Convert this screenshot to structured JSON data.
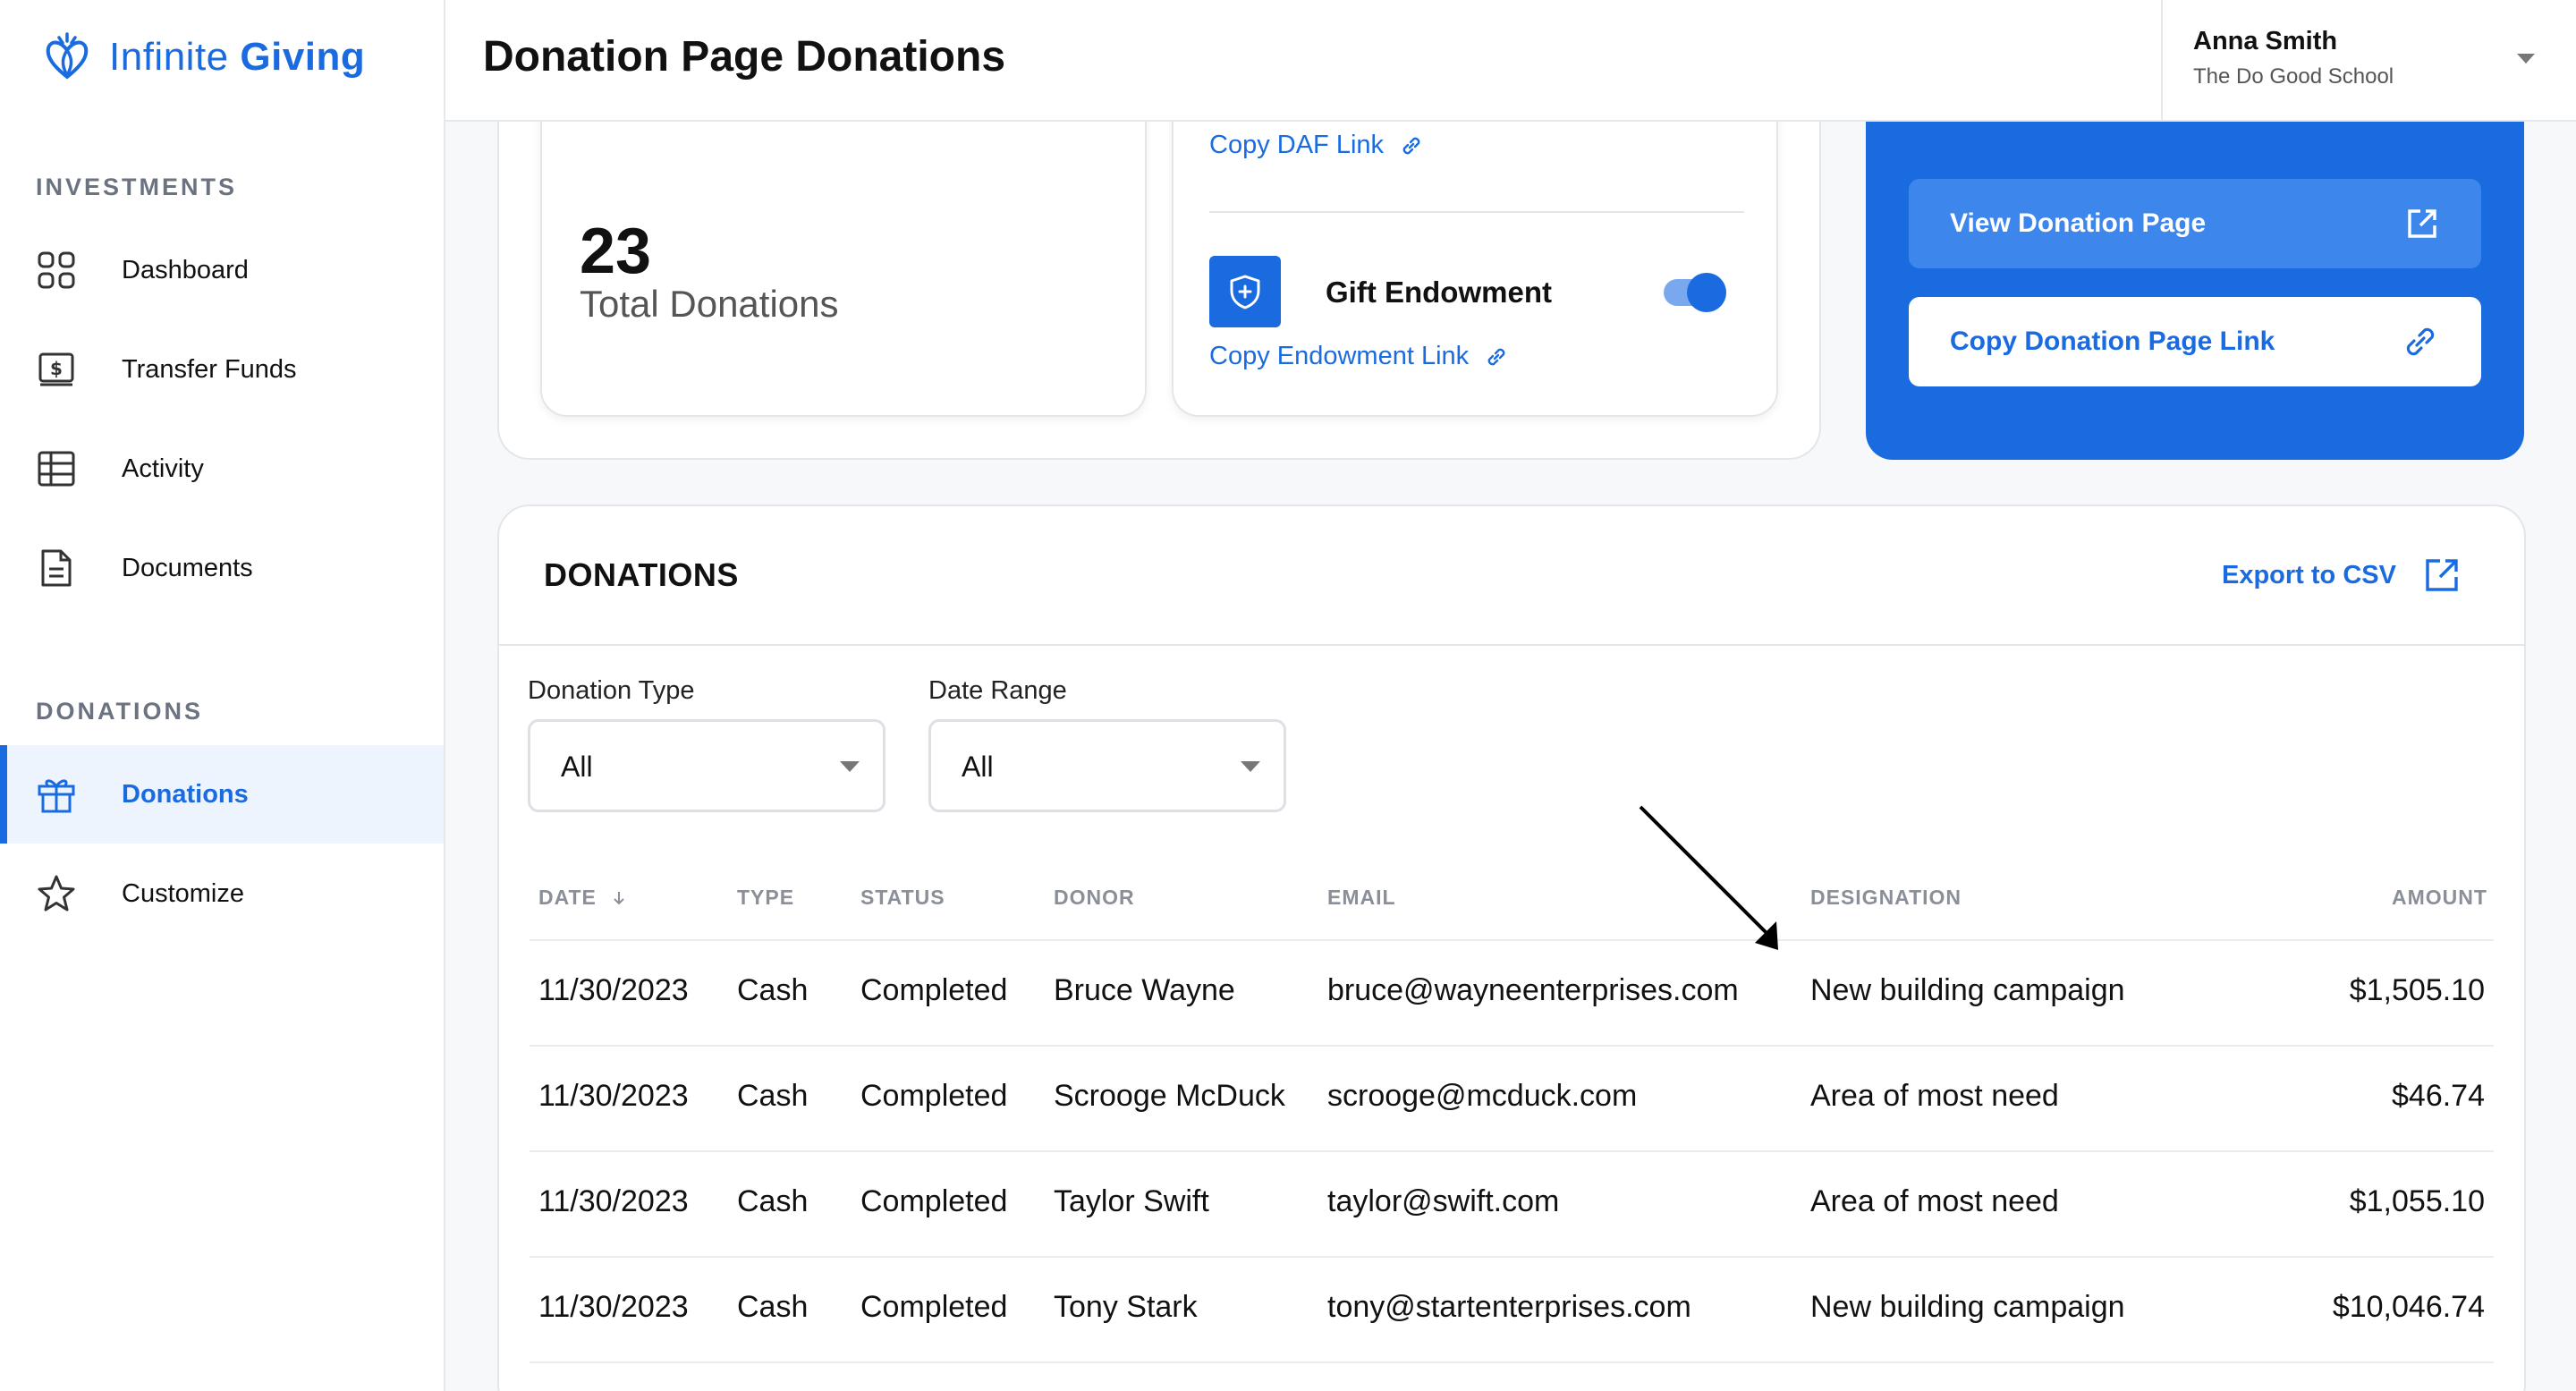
{
  "brand": {
    "name_light": "Infinite",
    "name_bold": "Giving",
    "color": "#1a6be0"
  },
  "sidebar": {
    "sections": [
      {
        "label": "INVESTMENTS"
      },
      {
        "label": "DONATIONS"
      }
    ],
    "items": [
      {
        "label": "Dashboard",
        "icon": "dashboard-icon"
      },
      {
        "label": "Transfer Funds",
        "icon": "dollar-bill-icon"
      },
      {
        "label": "Activity",
        "icon": "table-grid-icon"
      },
      {
        "label": "Documents",
        "icon": "document-icon"
      },
      {
        "label": "Donations",
        "icon": "gift-icon",
        "active": true
      },
      {
        "label": "Customize",
        "icon": "star-icon"
      }
    ]
  },
  "header": {
    "title": "Donation Page Donations",
    "user": {
      "name": "Anna Smith",
      "org": "The Do Good School"
    }
  },
  "summary": {
    "total_donations": "23",
    "total_label": "Total Donations",
    "copy_daf_link": "Copy DAF Link",
    "gift_endowment_label": "Gift Endowment",
    "gift_endowment_enabled": true,
    "copy_endowment_link": "Copy Endowment Link",
    "view_page_button": "View Donation Page",
    "copy_page_link_button": "Copy Donation Page Link"
  },
  "donations": {
    "title": "DONATIONS",
    "export_label": "Export to CSV",
    "filters": {
      "type_label": "Donation Type",
      "type_value": "All",
      "range_label": "Date Range",
      "range_value": "All"
    },
    "columns": [
      "DATE",
      "TYPE",
      "STATUS",
      "DONOR",
      "EMAIL",
      "DESIGNATION",
      "AMOUNT"
    ],
    "rows": [
      {
        "date": "11/30/2023",
        "type": "Cash",
        "status": "Completed",
        "donor": "Bruce Wayne",
        "email": "bruce@wayneenterprises.com",
        "designation": "New building campaign",
        "amount": "$1,505.10"
      },
      {
        "date": "11/30/2023",
        "type": "Cash",
        "status": "Completed",
        "donor": "Scrooge McDuck",
        "email": "scrooge@mcduck.com",
        "designation": "Area of most need",
        "amount": "$46.74"
      },
      {
        "date": "11/30/2023",
        "type": "Cash",
        "status": "Completed",
        "donor": "Taylor Swift",
        "email": "taylor@swift.com",
        "designation": "Area of most need",
        "amount": "$1,055.10"
      },
      {
        "date": "11/30/2023",
        "type": "Cash",
        "status": "Completed",
        "donor": "Tony Stark",
        "email": "tony@startenterprises.com",
        "designation": "New building campaign",
        "amount": "$10,046.74"
      }
    ]
  }
}
